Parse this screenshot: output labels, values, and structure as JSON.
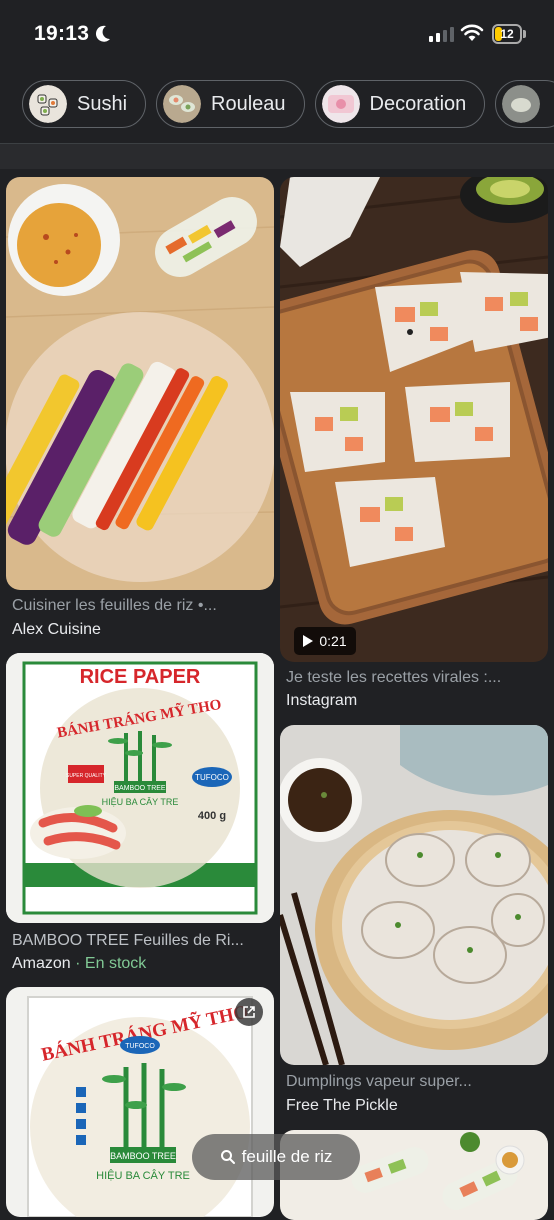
{
  "status": {
    "time": "19:13",
    "battery": "12"
  },
  "chips": [
    {
      "label": "Sushi"
    },
    {
      "label": "Rouleau"
    },
    {
      "label": "Decoration"
    }
  ],
  "results": [
    {
      "title": "Cuisiner les feuilles de riz •...",
      "source": "Alex Cuisine"
    },
    {
      "title": "Je teste les recettes virales :...",
      "source": "Instagram",
      "duration": "0:21"
    },
    {
      "title": "BAMBOO TREE Feuilles de Ri...",
      "source": "Amazon",
      "stock": "· En stock",
      "pack": {
        "header": "RICE PAPER",
        "brand_line": "BÁNH TRÁNG MỸ THO",
        "logo": "TUFOCO",
        "weight": "400 g",
        "bamboo": "BAMBOO TREE",
        "sub": "HIỆU BA CÂY TRE",
        "quality": "SUPER QUALITY"
      }
    },
    {
      "title": "Dumplings vapeur super...",
      "source": "Free The Pickle"
    },
    {
      "pack": {
        "brand_line": "BÁNH TRÁNG MỸ THO",
        "logo": "TUFOCO",
        "bamboo": "BAMBOO TREE",
        "sub": "HIỆU BA CÂY TRE"
      }
    }
  ],
  "search": {
    "query": "feuille de riz"
  },
  "colors": {
    "background": "#202124",
    "chip_border": "#5f6368",
    "stock_green": "#81c995"
  }
}
